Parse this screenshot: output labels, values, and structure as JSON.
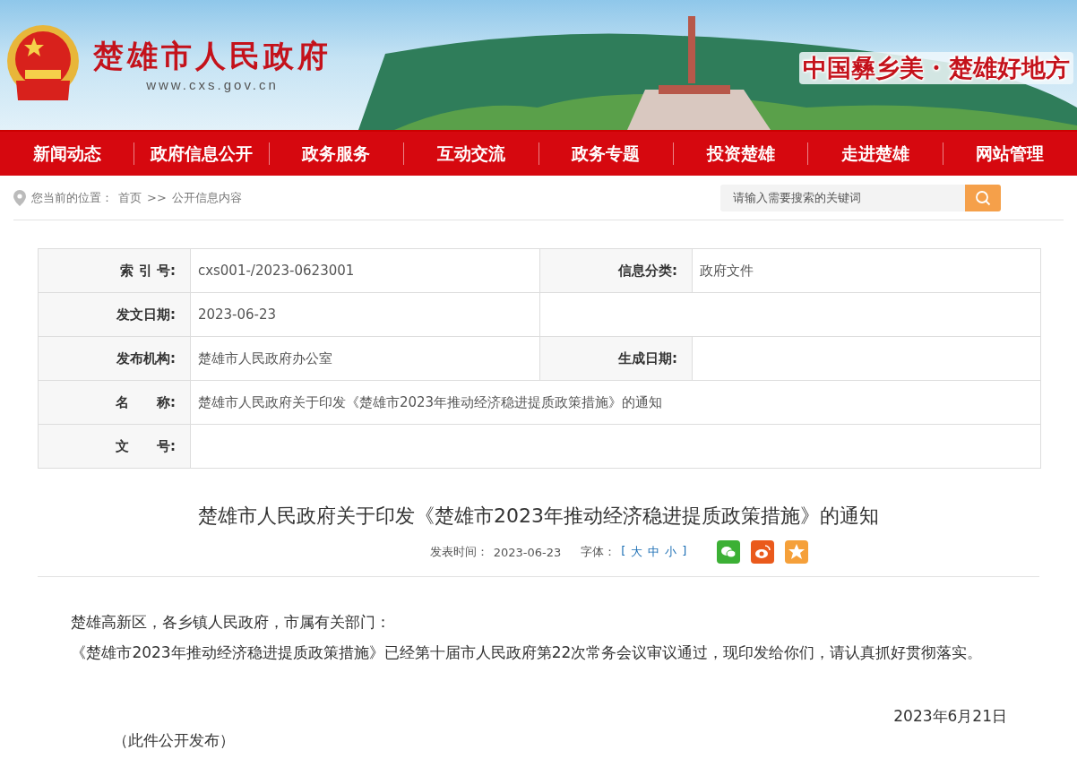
{
  "header": {
    "site_name": "楚雄市人民政府",
    "site_url": "www.cxs.gov.cn",
    "slogan": "中国彝乡美 · 楚雄好地方"
  },
  "nav": {
    "items": [
      "新闻动态",
      "政府信息公开",
      "政务服务",
      "互动交流",
      "政务专题",
      "投资楚雄",
      "走进楚雄",
      "网站管理"
    ]
  },
  "breadcrumb": {
    "label": "您当前的位置：",
    "items": [
      "首页",
      ">>",
      "公开信息内容"
    ]
  },
  "search": {
    "placeholder": "请输入需要搜索的关键词"
  },
  "info_table": {
    "rows": [
      {
        "kind": "pair",
        "fields": [
          {
            "label": "索 引 号:",
            "value": "cxs001-/2023-0623001"
          },
          {
            "label": "信息分类:",
            "value": "政府文件"
          }
        ]
      },
      {
        "kind": "single",
        "fields": [
          {
            "label": "发文日期:",
            "value": "2023-06-23"
          }
        ]
      },
      {
        "kind": "pair",
        "fields": [
          {
            "label": "发布机构:",
            "value": "楚雄市人民政府办公室"
          },
          {
            "label": "生成日期:"
          }
        ]
      },
      {
        "kind": "wide",
        "fields": [
          {
            "label": "名      称:",
            "value": "楚雄市人民政府关于印发《楚雄市2023年推动经济稳进提质政策措施》的通知"
          }
        ]
      },
      {
        "kind": "wide",
        "fields": [
          {
            "label": "文      号:"
          }
        ]
      }
    ]
  },
  "article": {
    "title": "楚雄市人民政府关于印发《楚雄市2023年推动经济稳进提质政策措施》的通知",
    "meta": {
      "published_label": "发表时间：",
      "published": "2023-06-23",
      "font_label": "字体：",
      "font_open": "[",
      "font_sizes": [
        "大",
        "中",
        "小"
      ],
      "font_close": "]"
    },
    "paragraphs": [
      "楚雄高新区，各乡镇人民政府，市属有关部门：",
      "《楚雄市2023年推动经济稳进提质政策措施》已经第十届市人民政府第22次常务会议审议通过，现印发给你们，请认真抓好贯彻落实。"
    ],
    "date": "2023年6月21日",
    "note": "（此件公开发布）"
  }
}
